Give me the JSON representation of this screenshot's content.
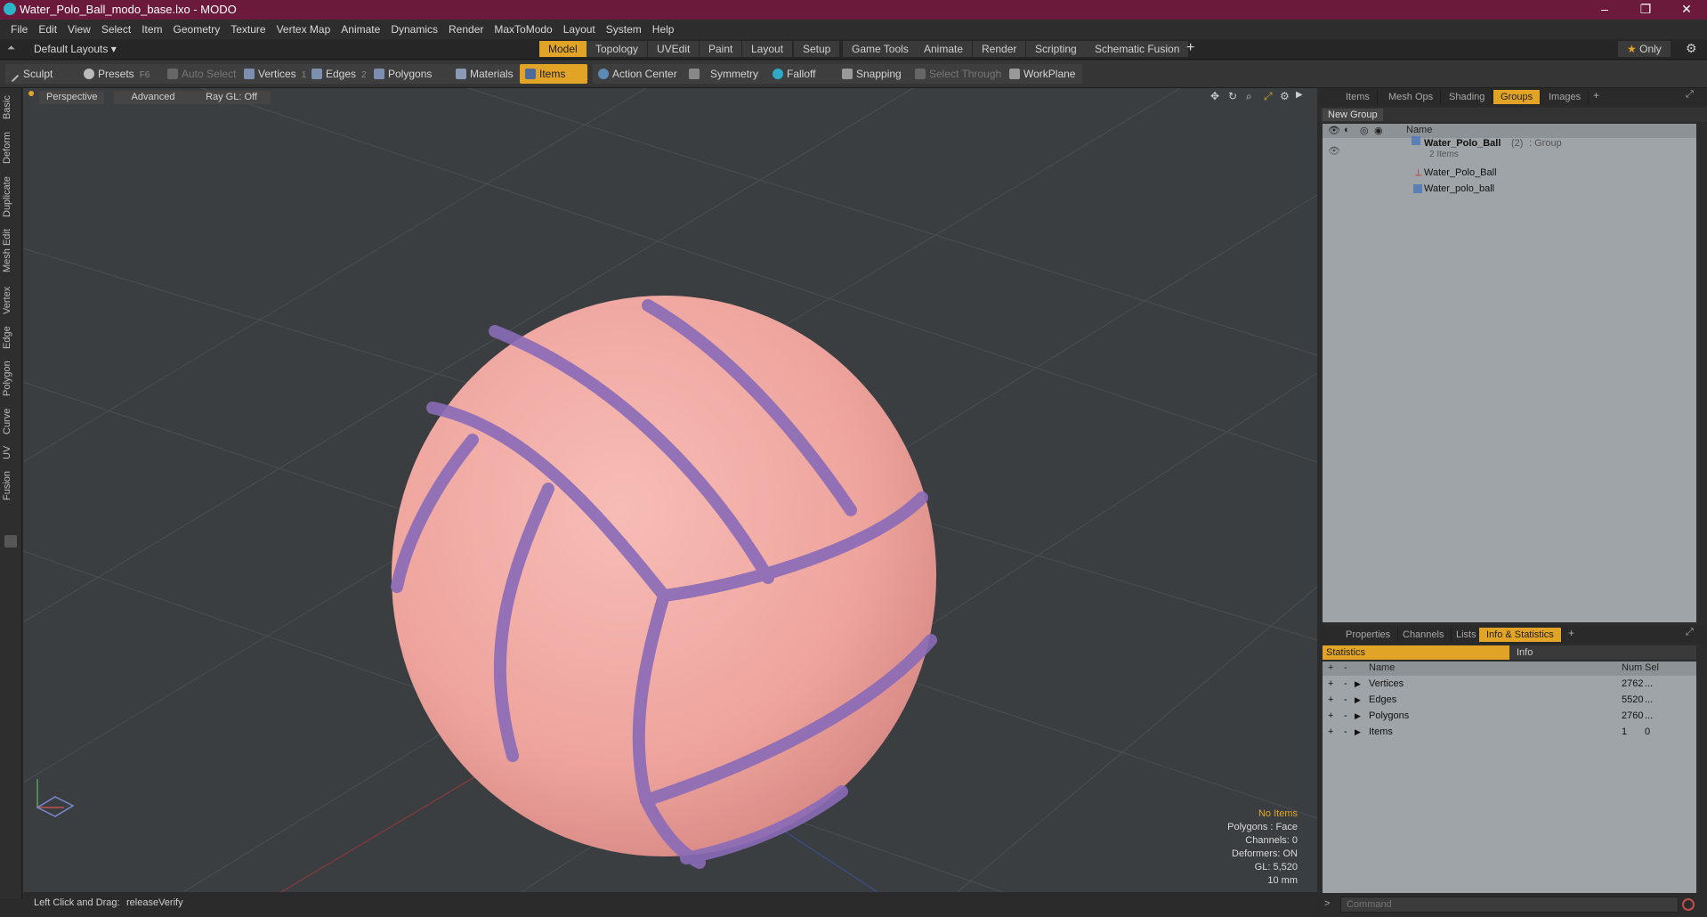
{
  "window": {
    "title": "Water_Polo_Ball_modo_base.lxo - MODO",
    "min": "–",
    "max": "❐",
    "close": "✕"
  },
  "menu": [
    "File",
    "Edit",
    "View",
    "Select",
    "Item",
    "Geometry",
    "Texture",
    "Vertex Map",
    "Animate",
    "Dynamics",
    "Render",
    "MaxToModo",
    "Layout",
    "System",
    "Help"
  ],
  "layoutbar": {
    "layout_name": "Default Layouts",
    "tabs": [
      "Model",
      "Topology",
      "UVEdit",
      "Paint",
      "Layout",
      "Setup",
      "Game Tools",
      "Animate",
      "Render",
      "Scripting",
      "Schematic Fusion"
    ],
    "active_tab": "Model",
    "add": "+",
    "only": "Only",
    "star": "★"
  },
  "toolbar": {
    "sculpt": "Sculpt",
    "presets": "Presets",
    "presets_key": "F6",
    "auto_select": "Auto Select",
    "vertices": "Vertices",
    "vertices_key": "1",
    "edges": "Edges",
    "edges_key": "2",
    "polygons": "Polygons",
    "materials": "Materials",
    "items": "Items",
    "action_center": "Action Center",
    "symmetry": "Symmetry",
    "falloff": "Falloff",
    "snapping": "Snapping",
    "select_through": "Select Through",
    "workplane": "WorkPlane"
  },
  "lefttabs": [
    "Basic",
    "Deform",
    "Duplicate",
    "Mesh Edit",
    "Vertex",
    "Edge",
    "Polygon",
    "Curve",
    "UV",
    "Fusion"
  ],
  "viewport": {
    "view": "Perspective",
    "shading": "Advanced",
    "raygl": "Ray GL: Off",
    "info": {
      "no_items": "No Items",
      "polygons": "Polygons : Face",
      "channels": "Channels: 0",
      "deformers": "Deformers: ON",
      "gl": "GL: 5,520",
      "scale": "10 mm"
    },
    "colors": {
      "ball": "#f2aaa5",
      "seam": "#8a6bb8",
      "bg": "#3a3e41"
    }
  },
  "status": {
    "hint": "Left Click and Drag:",
    "action": "releaseVerify"
  },
  "groups_panel": {
    "tabs": [
      "Items",
      "Mesh Ops",
      "Shading",
      "Groups",
      "Images"
    ],
    "active": "Groups",
    "new_group": "New Group",
    "col_name": "Name",
    "group": {
      "name": "Water_Polo_Ball",
      "count": "(2)",
      "type": ": Group",
      "sub": "2 Items"
    },
    "children": [
      "Water_Polo_Ball",
      "Water_polo_ball"
    ]
  },
  "stats_panel": {
    "tabs": [
      "Properties",
      "Channels",
      "Lists",
      "Info & Statistics"
    ],
    "active": "Info & Statistics",
    "subtabs": [
      "Statistics",
      "Info"
    ],
    "cols": {
      "name": "Name",
      "num": "Num",
      "sel": "Sel"
    },
    "rows": [
      {
        "name": "Vertices",
        "num": "2762",
        "sel": "..."
      },
      {
        "name": "Edges",
        "num": "5520",
        "sel": "..."
      },
      {
        "name": "Polygons",
        "num": "2760",
        "sel": "..."
      },
      {
        "name": "Items",
        "num": "1",
        "sel": "0"
      }
    ],
    "command_placeholder": "Command"
  }
}
